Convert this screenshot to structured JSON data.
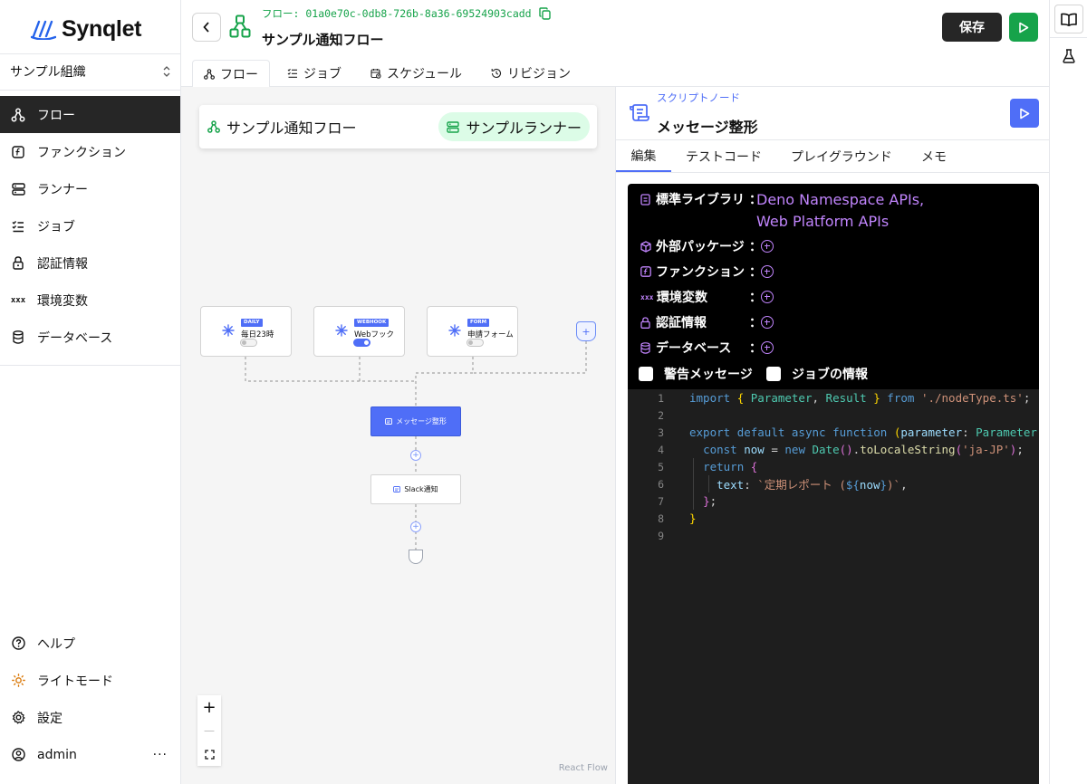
{
  "app": {
    "logo_text": "Synqlet"
  },
  "sidebar": {
    "org_selector": "サンプル組織",
    "items": [
      {
        "label": "フロー",
        "icon": "flow-icon",
        "active": true
      },
      {
        "label": "ファンクション",
        "icon": "function-icon"
      },
      {
        "label": "ランナー",
        "icon": "server-icon"
      },
      {
        "label": "ジョブ",
        "icon": "list-checks-icon"
      },
      {
        "label": "認証情報",
        "icon": "lock-icon"
      },
      {
        "label": "環境変数",
        "icon": "variable-icon"
      },
      {
        "label": "データベース",
        "icon": "database-icon"
      }
    ],
    "bottom": [
      {
        "label": "ヘルプ",
        "icon": "help-icon"
      },
      {
        "label": "ライトモード",
        "icon": "sun-icon"
      },
      {
        "label": "設定",
        "icon": "gear-icon"
      }
    ],
    "user": {
      "name": "admin",
      "more": "···"
    }
  },
  "header": {
    "flow_id": "フロー: 01a0e70c-0db8-726b-8a36-69524903cadd",
    "flow_title": "サンプル通知フロー",
    "save_label": "保存"
  },
  "tabs": [
    {
      "label": "フロー",
      "active": true
    },
    {
      "label": "ジョブ"
    },
    {
      "label": "スケジュール"
    },
    {
      "label": "リビジョン"
    }
  ],
  "canvas": {
    "flow_name": "サンプル通知フロー",
    "runner_name": "サンプルランナー",
    "triggers": [
      {
        "tag": "DAILY",
        "label": "毎日23時",
        "enabled": false
      },
      {
        "tag": "WEBHOOK",
        "label": "Webフック",
        "enabled": true
      },
      {
        "tag": "FORM",
        "label": "申請フォーム",
        "enabled": false
      }
    ],
    "add_trigger": "+",
    "nodes": [
      {
        "label": "メッセージ整形",
        "selected": true
      },
      {
        "label": "Slack通知",
        "selected": false
      }
    ],
    "zoom": {
      "in": "+",
      "out": "—"
    },
    "attribution": "React Flow"
  },
  "panel": {
    "node_type": "スクリプトノード",
    "node_title": "メッセージ整形",
    "tabs": [
      {
        "label": "編集",
        "active": true
      },
      {
        "label": "テストコード"
      },
      {
        "label": "プレイグラウンド"
      },
      {
        "label": "メモ"
      }
    ],
    "dependencies": {
      "std_lib_label": "標準ライブラリ",
      "std_lib_values": [
        "Deno Namespace APIs,",
        "Web Platform APIs"
      ],
      "rows": [
        {
          "label": "外部パッケージ",
          "icon": "package-icon"
        },
        {
          "label": "ファンクション",
          "icon": "function-icon"
        },
        {
          "label": "環境変数",
          "icon": "variable-icon"
        },
        {
          "label": "認証情報",
          "icon": "lock-icon"
        },
        {
          "label": "データベース",
          "icon": "database-icon"
        }
      ],
      "colon": "：",
      "checkbox_warning": "警告メッセージ",
      "checkbox_job_info": "ジョブの情報"
    },
    "code_lines": [
      "import { Parameter, Result } from './nodeType.ts';",
      "",
      "export default async function (parameter: Parameter): Promise<Result> {",
      "  const now = new Date().toLocaleString('ja-JP');",
      "  return {",
      "    text: `定期レポート (${now})`,",
      "  };",
      "}",
      ""
    ]
  },
  "colors": {
    "accent_green": "#16a34a",
    "accent_blue": "#4f6ef7",
    "dark": "#262626",
    "purple": "#c084fc"
  }
}
